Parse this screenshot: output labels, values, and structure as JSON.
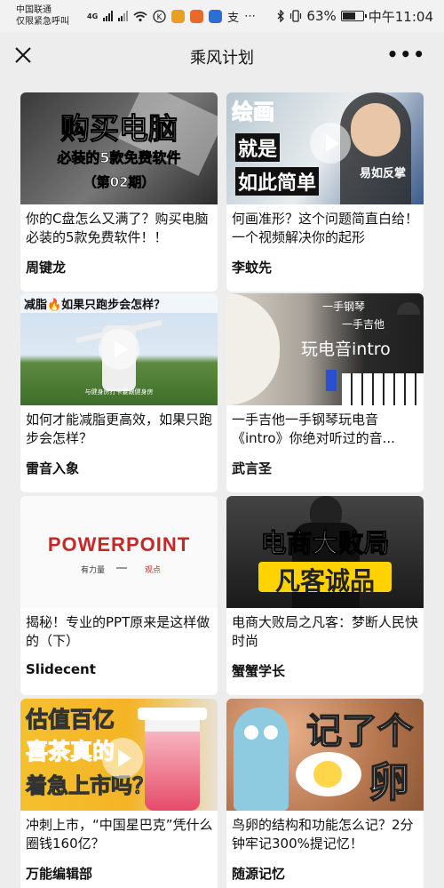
{
  "status": {
    "carrier_line1": "中国联通",
    "carrier_line2": "仅限紧急呼叫",
    "net": "4G",
    "battery": "63%",
    "time": "中午11:04"
  },
  "nav": {
    "title": "乘风计划"
  },
  "cards": [
    {
      "title": "你的C盘怎么又满了？购买电脑必装的5款免费软件！！",
      "author": "周键龙",
      "thumb": {
        "line1": "购买电脑",
        "line2": "必装的5款免费软件",
        "line3": "（第02期）"
      }
    },
    {
      "title": "何画准形？这个问题简直白给！一个视频解决你的起形",
      "author": "李蚊先",
      "thumb": {
        "line1": "绘画",
        "line2": "就是",
        "line3": "如此简单",
        "line4": "易如反掌"
      }
    },
    {
      "title": "如何才能减脂更高效，如果只跑步会怎样？",
      "author": "雷音入象",
      "thumb": {
        "line1": "减脂🔥如果只跑步会怎样？",
        "line2": "与健身房打卡要跟健身房"
      }
    },
    {
      "title": "一手吉他一手钢琴玩电音《intro》你绝对听过的音...",
      "author": "武言圣",
      "thumb": {
        "line1": "一手钢琴",
        "line2": "一手吉他",
        "line3": "玩电音intro"
      }
    },
    {
      "title": "揭秘！专业的PPT原来是这样做的（下）",
      "author": "Slidecent",
      "thumb": {
        "line1": "POWERPOINT",
        "line2": "有力量",
        "line3": "观点"
      }
    },
    {
      "title": "电商大败局之凡客：梦断人民快时尚",
      "author": "蟹蟹学长",
      "thumb": {
        "line1": "电商大败局",
        "line2": "凡客诚品"
      }
    },
    {
      "title": "冲刺上市，“中国星巴克”凭什么圈钱160亿？",
      "author": "万能编辑部",
      "thumb": {
        "line1": "估值百亿",
        "line2": "喜茶真的",
        "line3": "着急上市吗？"
      }
    },
    {
      "title": "鸟卵的结构和功能怎么记？2分钟牢记300%提记忆！",
      "author": "随源记忆",
      "thumb": {
        "line1": "记了个",
        "line2": "卵"
      }
    }
  ]
}
